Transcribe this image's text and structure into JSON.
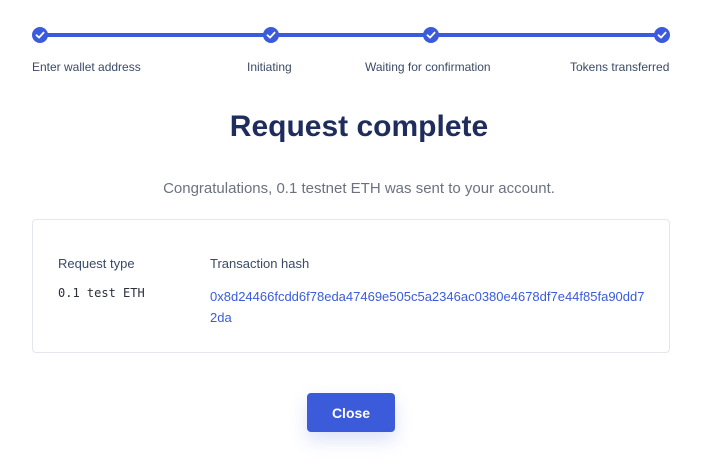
{
  "stepper": {
    "steps": [
      {
        "label": "Enter wallet address",
        "status": "complete"
      },
      {
        "label": "Initiating",
        "status": "complete"
      },
      {
        "label": "Waiting for confirmation",
        "status": "complete"
      },
      {
        "label": "Tokens transferred",
        "status": "complete"
      }
    ],
    "check_icon": "check-icon"
  },
  "heading": {
    "title": "Request complete",
    "message": "Congratulations, 0.1 testnet ETH was sent to your account."
  },
  "details": {
    "request_type_label": "Request type",
    "request_type_value": "0.1 test ETH",
    "tx_hash_label": "Transaction hash",
    "tx_hash_value": "0x8d24466fcdd6f78eda47469e505c5a2346ac0380e4678df7e44f85fa90dd72da"
  },
  "actions": {
    "close_label": "Close"
  },
  "colors": {
    "accent": "#3b5bdb",
    "title": "#1f2d5c",
    "muted_text": "#6a7282"
  }
}
